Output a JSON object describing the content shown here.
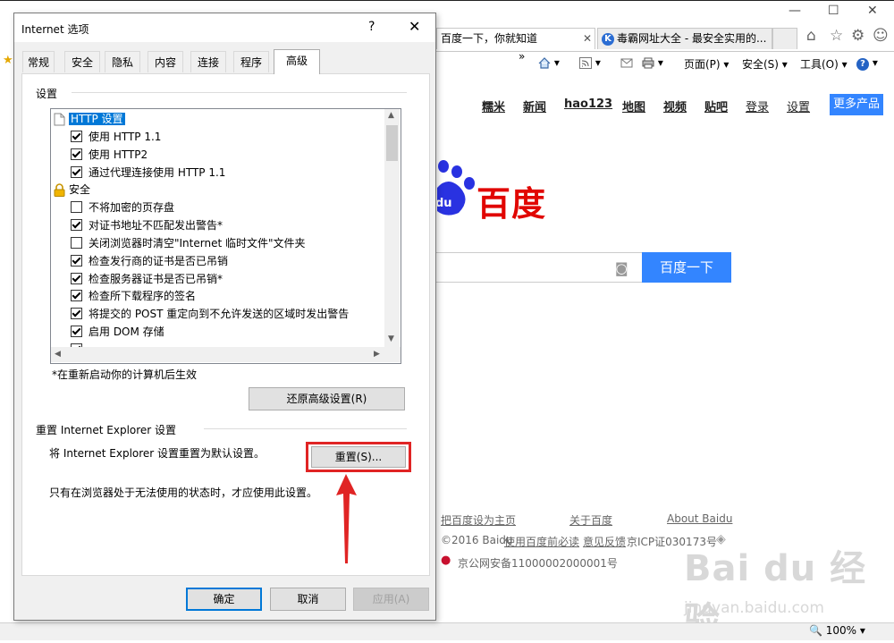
{
  "browser": {
    "tabs": [
      {
        "title": "百度一下，你就知道",
        "icon": "paw-icon"
      },
      {
        "title": "毒霸网址大全 - 最安全实用的...",
        "icon": "k-icon"
      }
    ],
    "commands": {
      "page": "页面(P)",
      "safety": "安全(S)",
      "tools": "工具(O)"
    },
    "zoom": "100%"
  },
  "baidu": {
    "nav": [
      "糯米",
      "新闻",
      "hao123",
      "地图",
      "视频",
      "贴吧",
      "登录",
      "设置"
    ],
    "more_products": "更多产品",
    "logo_text": "百度",
    "logo_du": "du",
    "search_button": "百度一下",
    "footer": {
      "set_home": "把百度设为主页",
      "about_cn": "关于百度",
      "about_en": "About  Baidu",
      "copyright": "©2016 Baidu",
      "must_read": "使用百度前必读",
      "feedback": "意见反馈",
      "icp": "京ICP证030173号",
      "police": "京公网安备11000002000001号"
    },
    "watermark": "Bai du 经验",
    "watermark_url": "jingyan.baidu.com"
  },
  "dialog": {
    "title": "Internet 选项",
    "help": "?",
    "close": "✕",
    "tabs": [
      "常规",
      "安全",
      "隐私",
      "内容",
      "连接",
      "程序",
      "高级"
    ],
    "active_tab": "高级",
    "settings_label": "设置",
    "settings": [
      {
        "label": "HTTP 设置",
        "type": "category",
        "icon": "page-icon",
        "selected": true
      },
      {
        "label": "使用 HTTP 1.1",
        "type": "checkbox",
        "checked": true
      },
      {
        "label": "使用 HTTP2",
        "type": "checkbox",
        "checked": true
      },
      {
        "label": "通过代理连接使用 HTTP 1.1",
        "type": "checkbox",
        "checked": true
      },
      {
        "label": "安全",
        "type": "category",
        "icon": "lock-icon"
      },
      {
        "label": "不将加密的页存盘",
        "type": "checkbox",
        "checked": false
      },
      {
        "label": "对证书地址不匹配发出警告*",
        "type": "checkbox",
        "checked": true
      },
      {
        "label": "关闭浏览器时清空\"Internet 临时文件\"文件夹",
        "type": "checkbox",
        "checked": false
      },
      {
        "label": "检查发行商的证书是否已吊销",
        "type": "checkbox",
        "checked": true
      },
      {
        "label": "检查服务器证书是否已吊销*",
        "type": "checkbox",
        "checked": true
      },
      {
        "label": "检查所下载程序的签名",
        "type": "checkbox",
        "checked": true
      },
      {
        "label": "将提交的 POST 重定向到不允许发送的区域时发出警告",
        "type": "checkbox",
        "checked": true
      },
      {
        "label": "启用 DOM 存储",
        "type": "checkbox",
        "checked": true
      }
    ],
    "restart_note": "*在重新启动你的计算机后生效",
    "restore_button": "还原高级设置(R)",
    "reset_group_label": "重置 Internet Explorer 设置",
    "reset_desc": "将 Internet Explorer 设置重置为默认设置。",
    "reset_button": "重置(S)...",
    "reset_warning": "只有在浏览器处于无法使用的状态时，才应使用此设置。",
    "ok": "确定",
    "cancel": "取消",
    "apply": "应用(A)"
  },
  "annotation": {
    "color": "#e02424"
  }
}
